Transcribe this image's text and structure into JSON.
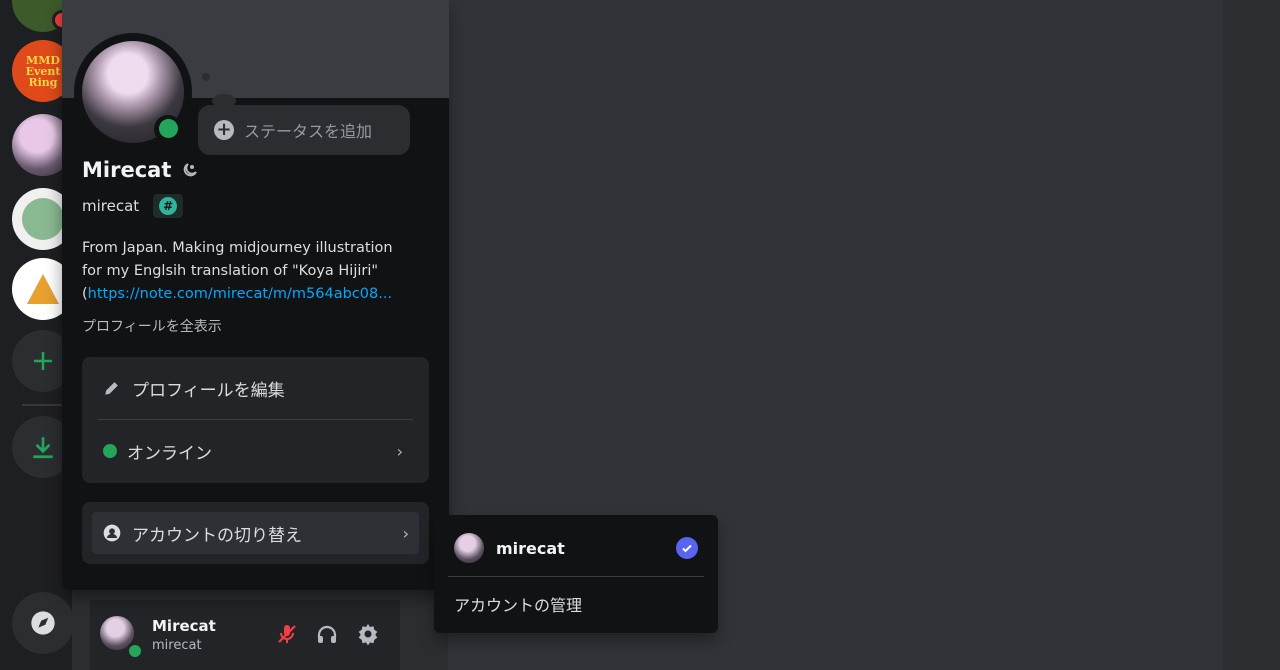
{
  "profile": {
    "display_name": "Mirecat",
    "username": "mirecat",
    "add_status": "ステータスを追加",
    "bio_line1": "From Japan. Making midjourney illustration",
    "bio_line2": "for my Englsih translation of \"Koya Hijiri\"",
    "bio_line3_prefix": "(",
    "bio_link": "https://note.com/mirecat/m/m564abc08...",
    "view_full_profile": "プロフィールを全表示",
    "edit_profile": "プロフィールを編集",
    "status_online": "オンライン",
    "switch_accounts": "アカウントの切り替え"
  },
  "account_menu": {
    "account_name": "mirecat",
    "manage_accounts": "アカウントの管理"
  },
  "user_bar": {
    "name": "Mirecat",
    "tag": "mirecat"
  },
  "server_rail": {
    "mmd_label": "MMD Event Ring"
  },
  "colors": {
    "online": "#23a55a",
    "accent": "#5865f2",
    "link": "#00a8fc",
    "muted_red": "#f23f43"
  }
}
